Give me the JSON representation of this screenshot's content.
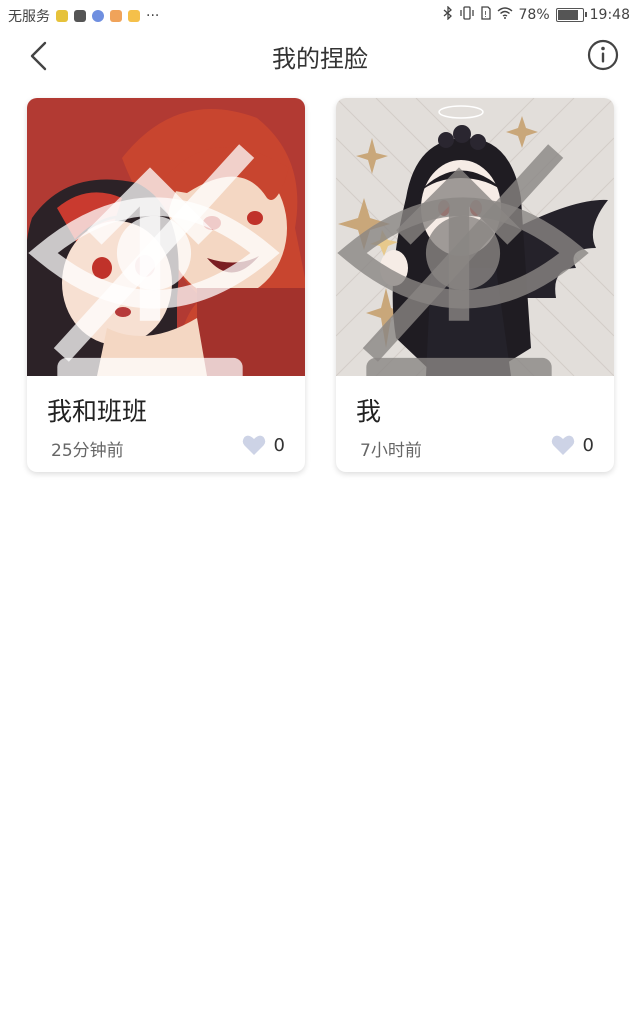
{
  "status_bar": {
    "carrier": "无服务",
    "dots": "···",
    "battery_percent": "78%",
    "time": "19:48",
    "battery_level": 0.78,
    "icons": [
      "bluetooth-icon",
      "vibrate-icon",
      "sim-icon",
      "wifi-icon",
      "battery-icon"
    ]
  },
  "header": {
    "title": "我的捏脸",
    "back_icon": "chevron-left-icon",
    "info_icon": "info-circle-icon"
  },
  "cards": [
    {
      "name": "我和班班",
      "time": "25分钟前",
      "likes": "0",
      "thumb_bg": "#b23a33"
    },
    {
      "name": "我",
      "time": "7小时前",
      "likes": "0",
      "thumb_bg": "#e2deda"
    }
  ],
  "colors": {
    "heart": "#cdd3e6",
    "card_shadow": "#d8d8d8"
  }
}
